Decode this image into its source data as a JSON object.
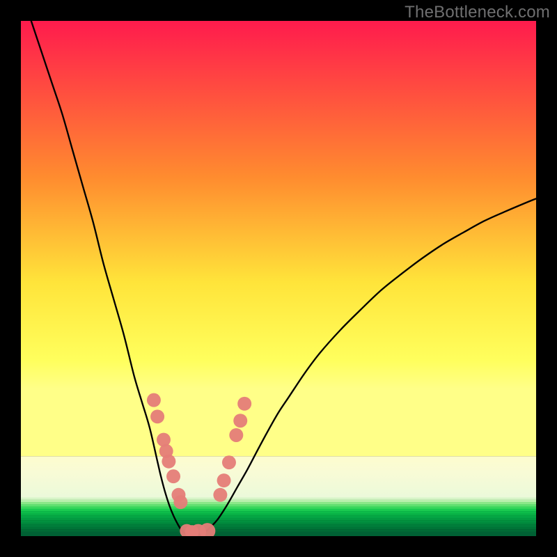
{
  "watermark": "TheBottleneck.com",
  "chart_data": {
    "type": "line",
    "title": "",
    "xlabel": "",
    "ylabel": "",
    "xlim": [
      0,
      100
    ],
    "ylim": [
      0,
      100
    ],
    "grid": false,
    "legend": false,
    "series": [
      {
        "name": "left-curve",
        "x": [
          2,
          4,
          6,
          8,
          10,
          12,
          14,
          16,
          18,
          20,
          22,
          23.5,
          25,
          26.5,
          27.2,
          28,
          28.8,
          29.6,
          30.4,
          31,
          31.6
        ],
        "y": [
          100,
          94,
          88,
          82,
          75,
          68,
          61,
          53,
          46,
          39,
          31,
          26,
          21,
          14.5,
          11.5,
          8.5,
          6,
          4,
          2.4,
          1.4,
          0.7
        ]
      },
      {
        "name": "right-curve",
        "x": [
          36,
          38,
          40,
          42,
          44,
          46,
          48,
          50,
          52,
          55,
          58,
          62,
          66,
          70,
          74,
          78,
          82,
          86,
          90,
          94,
          98,
          100
        ],
        "y": [
          1,
          3,
          6,
          9.5,
          13,
          16.8,
          20.5,
          24,
          27,
          31.5,
          35.5,
          40,
          44,
          47.8,
          51,
          54,
          56.7,
          59,
          61.2,
          63,
          64.7,
          65.5
        ]
      },
      {
        "name": "bottom-bridge",
        "x": [
          31.6,
          32.4,
          33.2,
          34,
          34.8,
          35.6,
          36
        ],
        "y": [
          0.7,
          0.4,
          0.2,
          0.2,
          0.3,
          0.6,
          1
        ]
      }
    ],
    "markers": [
      {
        "x": 25.8,
        "y": 26.4,
        "r": 1.35
      },
      {
        "x": 26.5,
        "y": 23.2,
        "r": 1.35
      },
      {
        "x": 27.7,
        "y": 18.7,
        "r": 1.35
      },
      {
        "x": 28.2,
        "y": 16.5,
        "r": 1.35
      },
      {
        "x": 28.7,
        "y": 14.5,
        "r": 1.35
      },
      {
        "x": 29.6,
        "y": 11.6,
        "r": 1.35
      },
      {
        "x": 30.6,
        "y": 8.0,
        "r": 1.35
      },
      {
        "x": 31.0,
        "y": 6.6,
        "r": 1.35
      },
      {
        "x": 32.2,
        "y": 1.0,
        "r": 1.35
      },
      {
        "x": 33.2,
        "y": 0.8,
        "r": 1.35
      },
      {
        "x": 34.4,
        "y": 0.8,
        "r": 1.55
      },
      {
        "x": 36.2,
        "y": 1.0,
        "r": 1.55
      },
      {
        "x": 38.7,
        "y": 8.0,
        "r": 1.35
      },
      {
        "x": 39.4,
        "y": 10.8,
        "r": 1.35
      },
      {
        "x": 40.4,
        "y": 14.3,
        "r": 1.35
      },
      {
        "x": 41.8,
        "y": 19.6,
        "r": 1.35
      },
      {
        "x": 42.6,
        "y": 22.4,
        "r": 1.35
      },
      {
        "x": 43.4,
        "y": 25.7,
        "r": 1.35
      }
    ]
  },
  "gradient": {
    "main_stops": [
      {
        "offset": 0,
        "color": "#ff1b4d"
      },
      {
        "offset": 36,
        "color": "#ff8c2f"
      },
      {
        "offset": 60,
        "color": "#ffe43a"
      },
      {
        "offset": 78,
        "color": "#ffff5d"
      },
      {
        "offset": 84.5,
        "color": "#ffff88"
      }
    ],
    "band_top_pct": 84.5,
    "pale_band_height_pct": 8.0,
    "pale_band_stops": [
      {
        "offset": 0,
        "color": "#fdfcce"
      },
      {
        "offset": 40,
        "color": "#f8fbd6"
      },
      {
        "offset": 100,
        "color": "#ebf9da"
      }
    ],
    "greens_top_pct": 92.5,
    "greens": [
      "#d7f5c8",
      "#b9f0ad",
      "#8be989",
      "#5fe270",
      "#37d85c",
      "#1acb50",
      "#0dbd4a",
      "#08b146",
      "#05a644",
      "#039b41",
      "#02913f",
      "#01873c",
      "#017d3a",
      "#007437",
      "#006b35"
    ],
    "bottom_fill": "#006134"
  }
}
